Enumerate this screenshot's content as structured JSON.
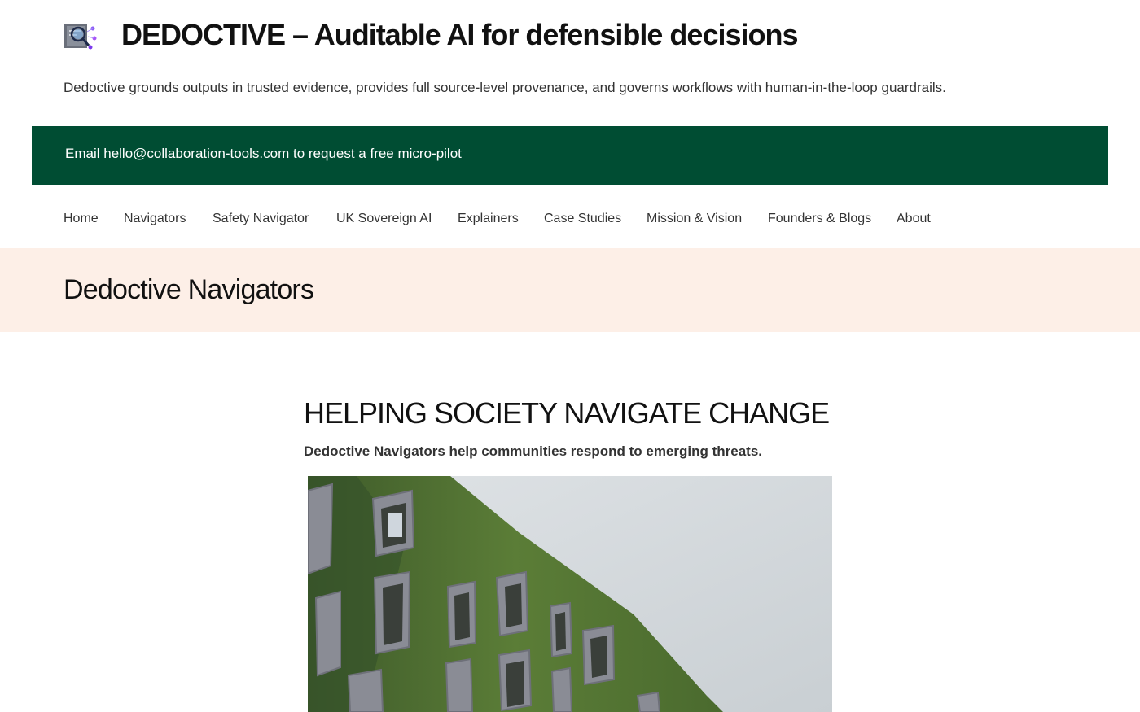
{
  "header": {
    "logo_icon": "magnifier-document-icon",
    "title": "DEDOCTIVE – Auditable AI for defensible decisions",
    "tagline": "Dedoctive grounds outputs in trusted evidence, provides full source-level provenance, and governs workflows with human-in-the-loop guardrails."
  },
  "banner": {
    "prefix": "Email",
    "email": "hello@collaboration-tools.com",
    "suffix": "to request a free micro-pilot",
    "background": "#004d33"
  },
  "nav": {
    "items": [
      "Home",
      "Navigators",
      "Safety Navigator",
      "UK Sovereign AI",
      "Explainers",
      "Case Studies",
      "Mission & Vision",
      "Founders & Blogs",
      "About"
    ]
  },
  "page": {
    "title": "Dedoctive Navigators",
    "band_color": "#fdefe7"
  },
  "content": {
    "heading": "HELPING SOCIETY NAVIGATE CHANGE",
    "subheading": "Dedoctive Navigators help communities respond to emerging threats."
  }
}
